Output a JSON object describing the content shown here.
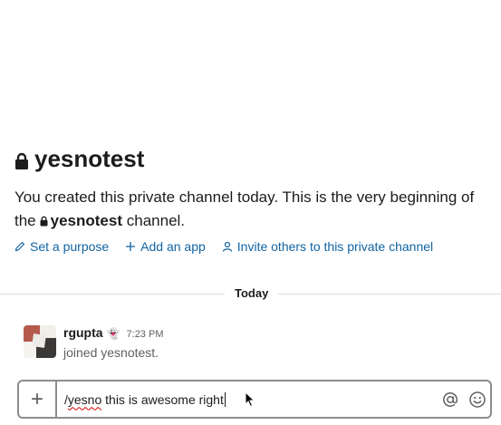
{
  "channel": {
    "name": "yesnotest",
    "intro_line": "You created this private channel today. This is the very beginning of the",
    "intro_suffix": "channel."
  },
  "actions": [
    {
      "icon": "pencil-icon",
      "label": "Set a purpose"
    },
    {
      "icon": "plus-icon",
      "label": "Add an app"
    },
    {
      "icon": "person-icon",
      "label": "Invite others to this private channel"
    }
  ],
  "divider_label": "Today",
  "message": {
    "username": "rgupta",
    "status_emoji": "👻",
    "timestamp": "7:23 PM",
    "body": "joined yesnotest."
  },
  "composer": {
    "plus_label": "+",
    "text_prefix": "/",
    "text_misspelled": "yesno",
    "text_rest": " this is awesome right"
  },
  "colors": {
    "link": "#1264a3",
    "muted": "#616061",
    "text": "#1d1c1d"
  }
}
